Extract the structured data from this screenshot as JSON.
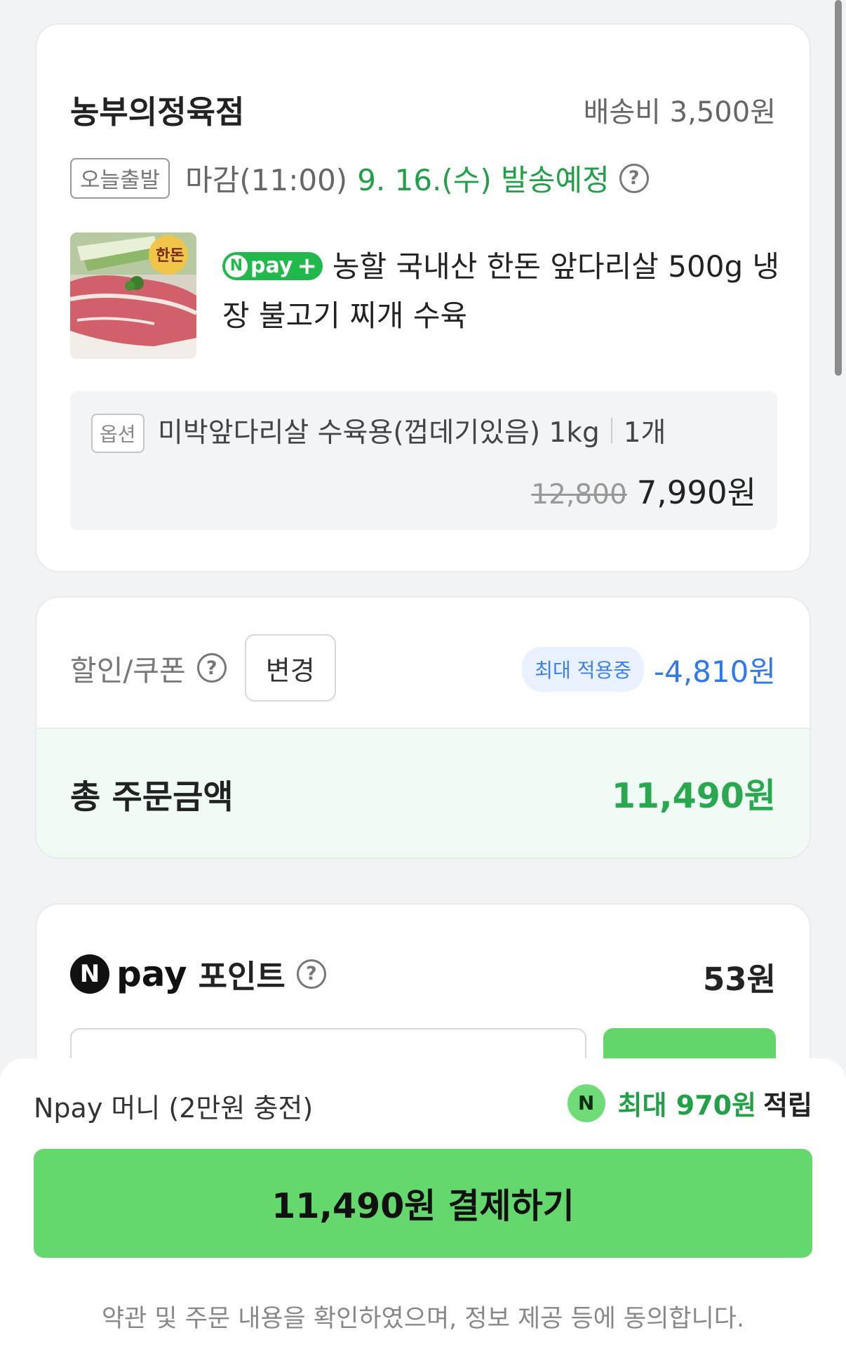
{
  "store": {
    "name": "농부의정육점",
    "shipping_fee": "배송비 3,500원",
    "today_badge": "오늘출발",
    "deadline": "마감(11:00)",
    "ship_date": "9. 16.(수) 발송예정"
  },
  "product": {
    "npay_badge": "pay",
    "npay_badge_n": "N",
    "npay_badge_plus": "+",
    "title": "농할 국내산 한돈 앞다리살 500g 냉장 불고기 찌개 수육",
    "option_tag": "옵션",
    "option_name": "미박앞다리살 수육용(껍데기있음) 1kg",
    "quantity": "1개",
    "original_price": "12,800",
    "sale_price": "7,990원",
    "thumb_brand": "한돈"
  },
  "discount": {
    "label": "할인/쿠폰",
    "change_button": "변경",
    "max_badge": "최대 적용중",
    "amount": "-4,810원"
  },
  "total": {
    "label": "총 주문금액",
    "amount": "11,490원"
  },
  "points": {
    "n_letter": "N",
    "pay_word": "pay",
    "label": "포인트",
    "value": "53원"
  },
  "bottom": {
    "money_label": "Npay 머니 (2만원 충전)",
    "reward_icon": "N",
    "reward_green": "최대 970원",
    "reward_dark": "적립",
    "pay_button": "11,490원 결제하기",
    "agree_text": "약관 및 주문 내용을 확인하였으며, 정보 제공 등에 동의합니다."
  },
  "colors": {
    "accent_green": "#21a047",
    "pay_button_green": "#64d86d",
    "discount_blue": "#2f78ee",
    "total_bg": "#effbf4"
  },
  "icons": {
    "help": "question-circle-icon",
    "thumb": "pork-product-image"
  }
}
